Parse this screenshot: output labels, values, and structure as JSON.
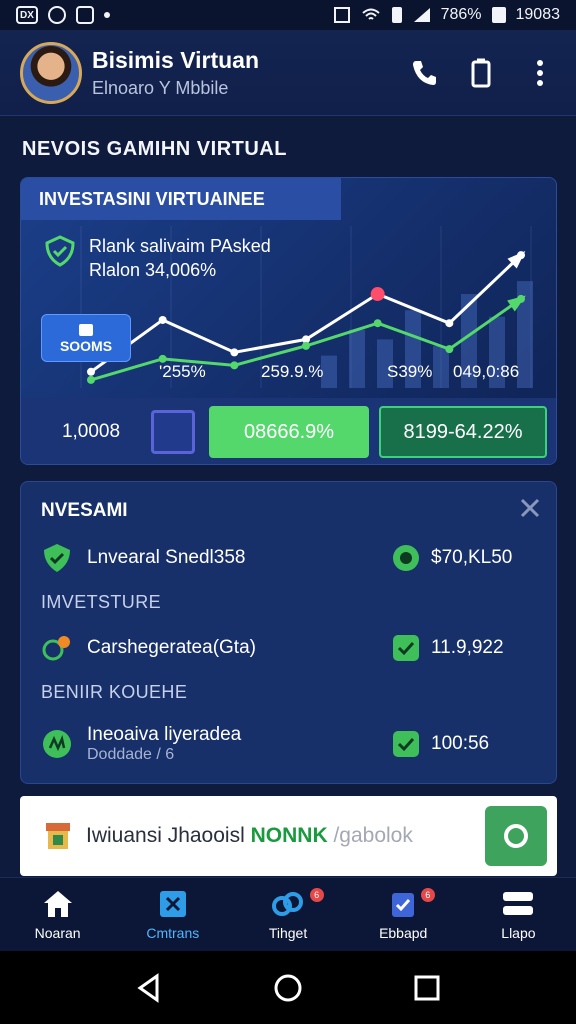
{
  "status_bar": {
    "left_icons": [
      "sim-badge-icon",
      "record-icon",
      "gallery-icon",
      "dots-icon"
    ],
    "sim_badge": "DX",
    "battery": "786%",
    "time": "19083"
  },
  "header": {
    "title": "Bisimis Virtuan",
    "subtitle": "Elnoaro Y Mbbile",
    "icons": [
      "phone-icon",
      "device-icon",
      "more-vertical-icon"
    ]
  },
  "section_title": "NEVOIS GAMIHN VIRTUAL",
  "chart_card": {
    "header": "INVESTASINI VIRTUAINEE",
    "rank_line1": "Rlank salivaim PAsked",
    "rank_line2": "Rlalon 34,006%",
    "small_badge": "SOOMS",
    "tick_labels": [
      "'255%",
      "259.9.%",
      "S39%",
      "049,0:86"
    ],
    "bottom_value": "1,0008",
    "green_button": "08666.9%",
    "outline_button": "8199-64.22%",
    "colors": {
      "green": "#54d86c",
      "line": "#8fb4ff",
      "accent": "#ff4d6a"
    }
  },
  "chart_data": {
    "type": "line",
    "series": [
      {
        "values": [
          10,
          42,
          22,
          30,
          58,
          40,
          82
        ]
      },
      {
        "values": [
          5,
          18,
          14,
          26,
          40,
          24,
          55
        ]
      }
    ],
    "bars": [
      20,
      36,
      30,
      48,
      26,
      58,
      44,
      66
    ]
  },
  "invest_card": {
    "title": "NVESAMI",
    "rows": [
      {
        "label": "Lnvearal Snedl358",
        "value": "$70,KL50",
        "icon": "shield-check-icon",
        "right_icon": "gear-check-icon"
      },
      {
        "label": "Carshegeratea(Gta)",
        "value": "11.9,922",
        "icon": "gear-leaf-icon",
        "right_icon": "check-box-icon"
      },
      {
        "label": "Ineoaiva liyeradea",
        "sub": "Doddade / 6",
        "value": "100:56",
        "icon": "coin-icon",
        "right_icon": "check-box-icon"
      }
    ],
    "sub_headings": [
      "IMVETSTURE",
      "BENIIR KOUEHE"
    ]
  },
  "search": {
    "prefix": "Iwiuansi Jhaooisl",
    "highlight": "NONNK",
    "placeholder": "/gabolok"
  },
  "bottom_nav": [
    {
      "label": "Noaran",
      "icon": "home-icon",
      "active": false
    },
    {
      "label": "Cmtrans",
      "icon": "tag-icon",
      "active": true
    },
    {
      "label": "Tihget",
      "icon": "link-icon",
      "active": false,
      "badge": "6"
    },
    {
      "label": "Ebbapd",
      "icon": "clipboard-icon",
      "active": false,
      "badge": "6"
    },
    {
      "label": "Llapo",
      "icon": "menu-icon",
      "active": false
    }
  ]
}
